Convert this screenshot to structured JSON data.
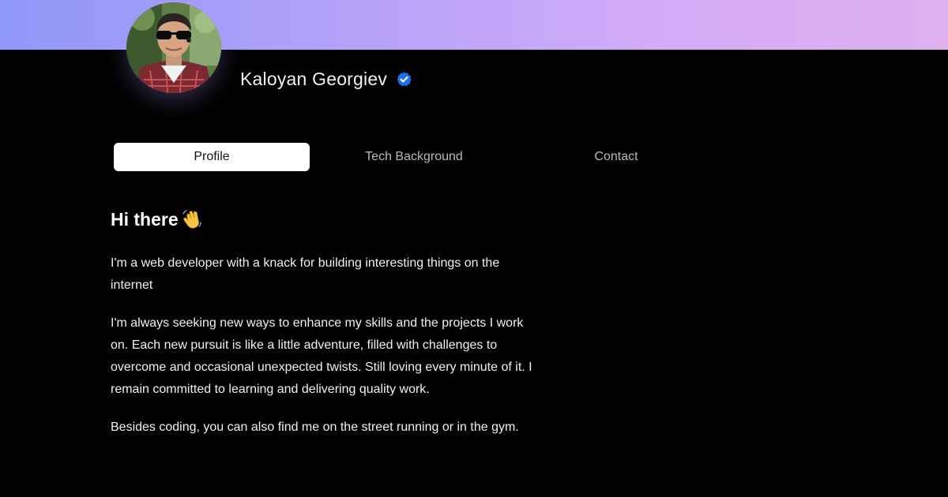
{
  "header": {
    "banner_gradient": [
      "#8f98f8",
      "#b3a1f9",
      "#d3abf7",
      "#e0b0ef"
    ],
    "avatar_icon": "profile-photo",
    "name": "Kaloyan Georgiev",
    "verified_icon": "verified-badge-icon",
    "verified_color": "#1f6feb"
  },
  "tabs": [
    {
      "label": "Profile",
      "active": true
    },
    {
      "label": "Tech Background",
      "active": false
    },
    {
      "label": "Contact",
      "active": false
    }
  ],
  "content": {
    "heading": "Hi there",
    "heading_icon": "waving-hand-icon",
    "paragraphs": [
      "I'm a web developer with a knack for building interesting things on the internet",
      "I'm always seeking new ways to enhance my skills and the projects I work on. Each new pursuit is like a little adventure, filled with challenges to overcome and occasional unexpected twists. Still loving every minute of it. I remain committed to learning and delivering quality work.",
      "Besides coding, you can also find me on the street running or in the gym."
    ]
  }
}
